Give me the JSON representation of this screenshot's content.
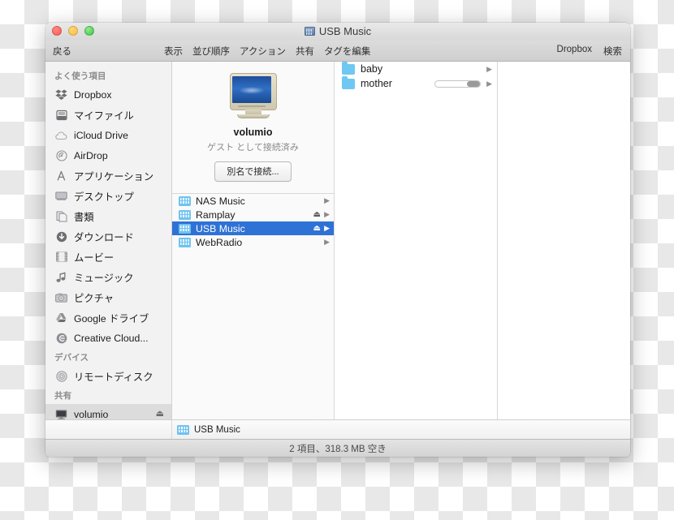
{
  "window": {
    "title": "USB Music",
    "title_icon": "server-icon",
    "traffic_lights": [
      "close",
      "minimize",
      "zoom"
    ]
  },
  "toolbar": {
    "back_label": "戻る",
    "items": [
      {
        "label": "表示",
        "name": "view"
      },
      {
        "label": "並び順序",
        "name": "arrange"
      },
      {
        "label": "アクション",
        "name": "action"
      },
      {
        "label": "共有",
        "name": "share"
      },
      {
        "label": "タグを編集",
        "name": "edit-tags"
      }
    ],
    "right_items": [
      {
        "label": "Dropbox",
        "name": "dropbox"
      },
      {
        "label": "検索",
        "name": "search"
      }
    ]
  },
  "sidebar": {
    "sections": [
      {
        "header": "よく使う項目",
        "items": [
          {
            "label": "Dropbox",
            "icon": "dropbox-icon"
          },
          {
            "label": "マイファイル",
            "icon": "all-my-files-icon"
          },
          {
            "label": "iCloud Drive",
            "icon": "cloud-icon"
          },
          {
            "label": "AirDrop",
            "icon": "airdrop-icon"
          },
          {
            "label": "アプリケーション",
            "icon": "applications-icon"
          },
          {
            "label": "デスクトップ",
            "icon": "desktop-icon"
          },
          {
            "label": "書類",
            "icon": "documents-icon"
          },
          {
            "label": "ダウンロード",
            "icon": "downloads-icon"
          },
          {
            "label": "ムービー",
            "icon": "movies-icon"
          },
          {
            "label": "ミュージック",
            "icon": "music-icon"
          },
          {
            "label": "ピクチャ",
            "icon": "pictures-icon"
          },
          {
            "label": "Google ドライブ",
            "icon": "google-drive-icon"
          },
          {
            "label": "Creative Cloud...",
            "icon": "creative-cloud-icon"
          }
        ]
      },
      {
        "header": "デバイス",
        "items": [
          {
            "label": "リモートディスク",
            "icon": "remote-disc-icon"
          }
        ]
      },
      {
        "header": "共有",
        "items": [
          {
            "label": "volumio",
            "icon": "server-icon",
            "selected": true,
            "eject": "⏏"
          }
        ]
      }
    ]
  },
  "preview": {
    "icon": "crt-server-icon",
    "name": "volumio",
    "status": "ゲスト として接続済み",
    "connect_button": "別名で接続..."
  },
  "shares": {
    "items": [
      {
        "label": "NAS Music",
        "icon": "network-share-icon",
        "eject": "",
        "arrow": "▶",
        "selected": false
      },
      {
        "label": "Ramplay",
        "icon": "network-share-icon",
        "eject": "⏏",
        "arrow": "▶",
        "selected": false
      },
      {
        "label": "USB Music",
        "icon": "network-share-icon",
        "eject": "⏏",
        "arrow": "▶",
        "selected": true
      },
      {
        "label": "WebRadio",
        "icon": "network-share-icon",
        "eject": "",
        "arrow": "▶",
        "selected": false
      }
    ]
  },
  "folders": {
    "items": [
      {
        "label": "baby",
        "icon": "folder-icon",
        "arrow": "▶",
        "has_scrollbar": false
      },
      {
        "label": "mother",
        "icon": "folder-icon",
        "arrow": "▶",
        "has_scrollbar": true
      }
    ]
  },
  "pathbar": {
    "icon": "network-share-icon",
    "label": "USB Music"
  },
  "statusbar": {
    "text": "2 項目、318.3 MB 空き"
  },
  "colors": {
    "selection_blue": "#2f72d6",
    "folder_blue": "#6ec8f2",
    "sidebar_bg": "#f2f2f3"
  }
}
